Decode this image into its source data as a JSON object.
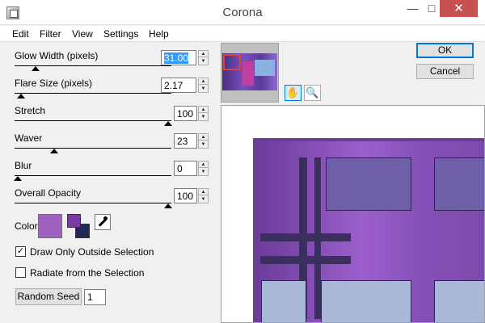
{
  "window": {
    "title": "Corona",
    "minimize": "—",
    "maximize": "□",
    "close": "✕"
  },
  "menu": [
    "Edit",
    "Filter",
    "View",
    "Settings",
    "Help"
  ],
  "controls": [
    {
      "label": "Glow Width (pixels)",
      "value": "31.00",
      "position": 0.12
    },
    {
      "label": "Flare Size (pixels)",
      "value": "2.17",
      "position": 0.02
    },
    {
      "label": "Stretch",
      "value": "100",
      "position": 1.0
    },
    {
      "label": "Waver",
      "value": "23",
      "position": 0.24
    },
    {
      "label": "Blur",
      "value": "0",
      "position": 0.0
    },
    {
      "label": "Overall Opacity",
      "value": "100",
      "position": 1.0
    }
  ],
  "color": {
    "label": "Color",
    "main": "#a060c0",
    "foreground": "#7a3aa0",
    "background": "#1f2a55"
  },
  "options": [
    {
      "label": "Draw Only Outside Selection",
      "checked": true
    },
    {
      "label": "Radiate from the Selection",
      "checked": false
    }
  ],
  "random_seed": {
    "label": "Random Seed",
    "value": "1"
  },
  "buttons": {
    "ok": "OK",
    "cancel": "Cancel"
  },
  "tools": {
    "pan": "pan-hand-icon",
    "zoom": "zoom-magnifier-icon"
  }
}
